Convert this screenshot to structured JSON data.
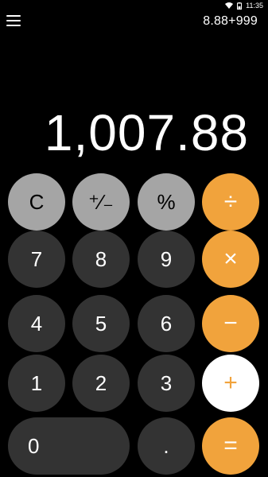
{
  "status_bar": {
    "time": "11:35"
  },
  "header": {
    "expression": "8.88+999"
  },
  "display": {
    "value": "1,007.88"
  },
  "keys": {
    "clear": "C",
    "sign": "⁺∕₋",
    "percent": "%",
    "divide": "÷",
    "seven": "7",
    "eight": "8",
    "nine": "9",
    "multiply": "×",
    "four": "4",
    "five": "5",
    "six": "6",
    "minus": "−",
    "one": "1",
    "two": "2",
    "three": "3",
    "plus": "+",
    "zero": "0",
    "decimal": ".",
    "equals": "="
  },
  "colors": {
    "background": "#000000",
    "function_key": "#a5a5a5",
    "digit_key": "#333333",
    "operator_key": "#f1a33c",
    "active_operator_key": "#ffffff"
  },
  "active_operator": "plus"
}
